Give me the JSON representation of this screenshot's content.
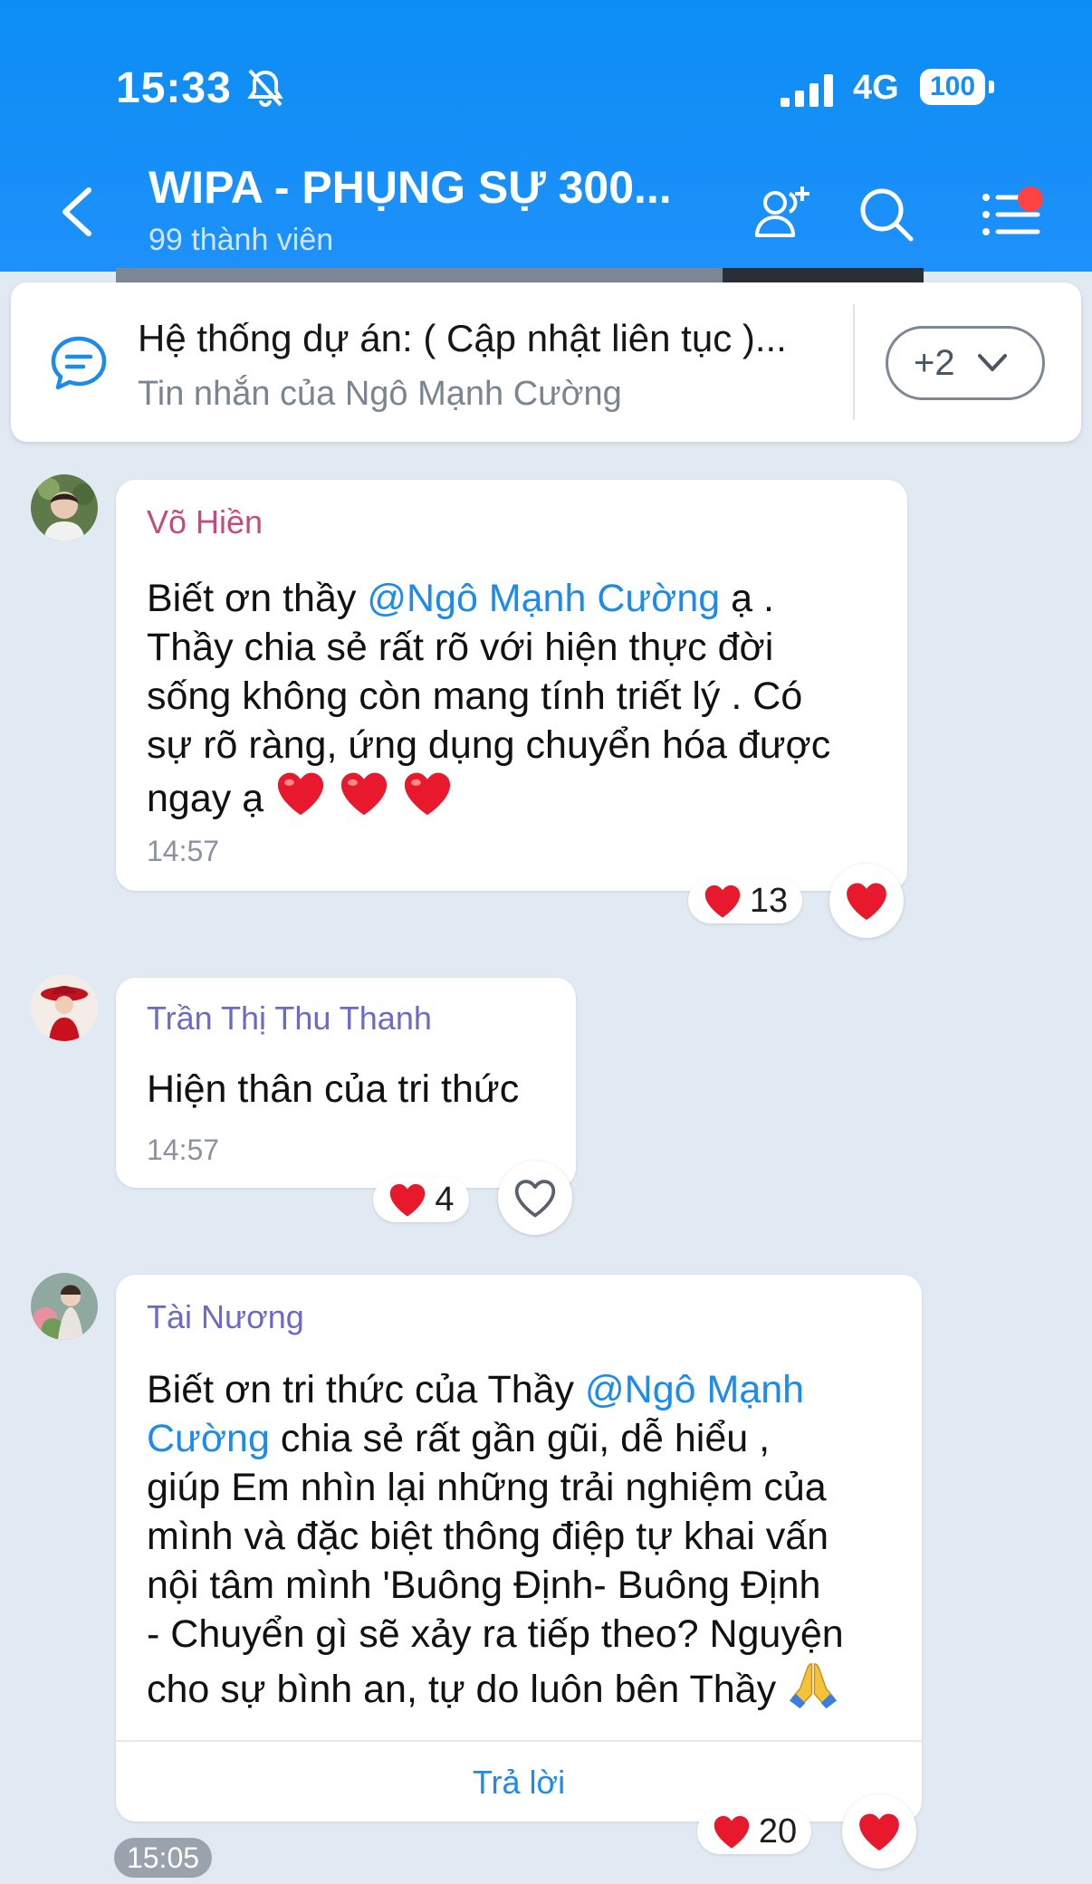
{
  "status_bar": {
    "time": "15:33",
    "network": "4G",
    "battery": "100"
  },
  "header": {
    "title": "WIPA - PHỤNG SỰ 300...",
    "subtitle": "99 thành viên"
  },
  "pinned": {
    "title": "Hệ thống dự án: ( Cập nhật liên tục )...",
    "subtitle": "Tin nhắn của Ngô Mạnh Cường",
    "more_label": "+2"
  },
  "messages": [
    {
      "sender": "Võ Hiền",
      "sender_color": "#c44b7c",
      "lines": [
        {
          "pre": "Biết ơn thầy ",
          "mention": "@Ngô Mạnh Cường",
          "post": " ạ ."
        },
        {
          "text": "Thầy chia sẻ rất rõ với hiện thực đời"
        },
        {
          "text": "sống không còn mang tính triết lý . Có"
        },
        {
          "text": "sự rõ ràng, ứng dụng chuyển hóa được"
        },
        {
          "text": "ngay ạ"
        }
      ],
      "time": "14:57",
      "reaction_count": "13"
    },
    {
      "sender": "Trần Thị Thu Thanh",
      "sender_color": "#6b6bc7",
      "lines": [
        {
          "text": "Hiện thân của tri thức"
        }
      ],
      "time": "14:57",
      "reaction_count": "4"
    },
    {
      "sender": "Tài Nương",
      "sender_color": "#6b6bc7",
      "lines": [
        {
          "pre": "Biết ơn tri thức của Thầy ",
          "mention": "@Ngô Mạnh"
        },
        {
          "mention": "Cường",
          "post": " chia sẻ rất gần gũi, dễ hiểu ,"
        },
        {
          "text": "giúp Em nhìn lại những trải nghiệm của"
        },
        {
          "text": "mình và đặc biệt thông điệp tự khai vấn"
        },
        {
          "text": "nội tâm mình 'Buông Định- Buông Định"
        },
        {
          "text": "- Chuyển gì sẽ xảy ra tiếp theo? Nguyện"
        },
        {
          "text": "cho sự bình an, tự do luôn bên Thầy"
        }
      ],
      "reply_label": "Trả lời",
      "reaction_count": "20"
    }
  ],
  "time_chip": "15:05",
  "colors": {
    "header": "#0b8ef3",
    "mention": "#1b8cec",
    "background": "#e1e9f2"
  },
  "icons": [
    "back-icon",
    "add-member-icon",
    "search-icon",
    "menu-icon",
    "chat-icon",
    "chevron-down-icon",
    "heart-icon",
    "heart-outline-icon",
    "pray-icon",
    "bell-off-icon",
    "signal-icon"
  ]
}
